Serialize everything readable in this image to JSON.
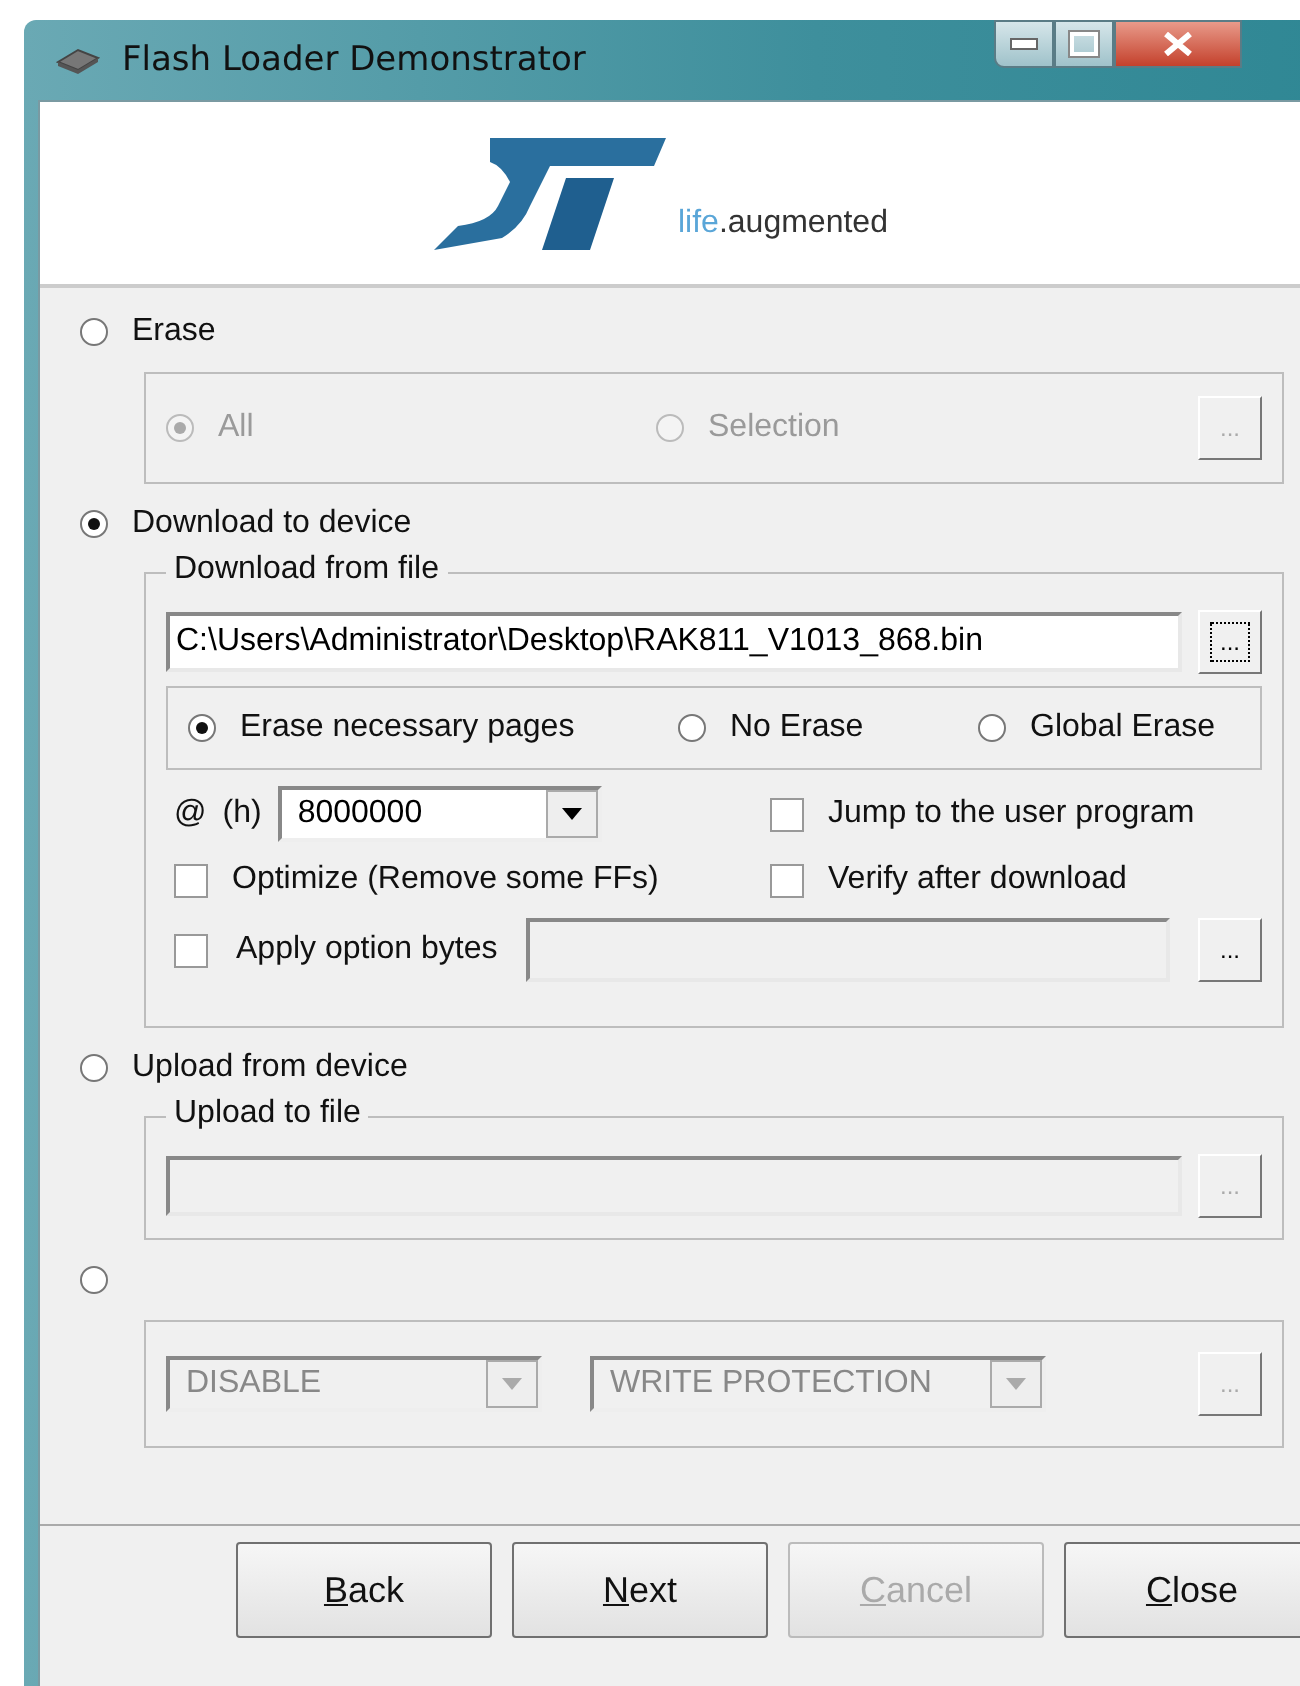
{
  "window": {
    "title": "Flash Loader Demonstrator"
  },
  "logo": {
    "tagline_prefix": "life",
    "tagline_suffix": ".augmented"
  },
  "modes": [
    {
      "kind": "erase",
      "label": "Erase",
      "selected": false,
      "options": [
        {
          "label": "All",
          "selected": true,
          "disabled": true
        },
        {
          "label": "Selection",
          "selected": false,
          "disabled": true
        }
      ],
      "browse": {
        "label": "...",
        "disabled": true,
        "focused": false
      }
    },
    {
      "kind": "download",
      "label": "Download to device",
      "selected": true,
      "legend": "Download from file",
      "file": {
        "value": "C:\\Users\\Administrator\\Desktop\\RAK811_V1013_868.bin"
      },
      "file_browse": {
        "label": "...",
        "disabled": false,
        "focused": true
      },
      "erase_options": [
        {
          "label": "Erase necessary pages",
          "selected": true
        },
        {
          "label": "No Erase",
          "selected": false
        },
        {
          "label": "Global Erase",
          "selected": false
        }
      ],
      "address": {
        "label": "@",
        "unit": "(h)",
        "value": "8000000"
      },
      "checkboxes": [
        {
          "label": "Jump to the user program",
          "checked": false
        },
        {
          "label": "Optimize (Remove some FFs)",
          "checked": false
        },
        {
          "label": "Verify after download",
          "checked": false
        },
        {
          "label": "Apply option bytes",
          "checked": false
        }
      ],
      "option_browse": {
        "label": "...",
        "disabled": false,
        "focused": false
      }
    },
    {
      "kind": "upload",
      "label": "Upload from device",
      "selected": false,
      "legend": "Upload to file",
      "browse": {
        "label": "...",
        "disabled": true,
        "focused": false
      }
    },
    {
      "kind": "protection",
      "selected": false,
      "dropdowns": [
        {
          "value": "DISABLE",
          "disabled": true
        },
        {
          "value": "WRITE PROTECTION",
          "disabled": true
        }
      ],
      "browse": {
        "label": "...",
        "disabled": true,
        "focused": false
      }
    }
  ],
  "buttons": [
    {
      "label": "Back",
      "disabled": false
    },
    {
      "label": "Next",
      "disabled": false
    },
    {
      "label": "Cancel",
      "disabled": true
    },
    {
      "label": "Close",
      "disabled": false
    }
  ]
}
